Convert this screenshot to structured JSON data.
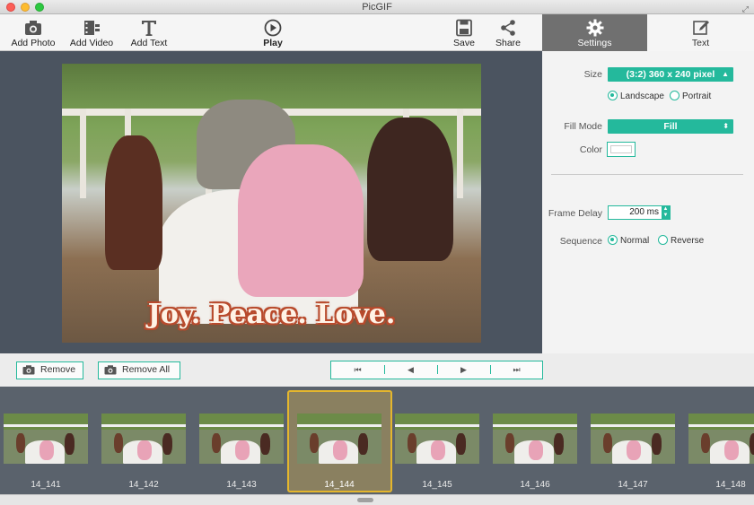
{
  "window": {
    "title": "PicGIF"
  },
  "toolbar": {
    "add_photo": "Add Photo",
    "add_video": "Add Video",
    "add_text": "Add Text",
    "play": "Play",
    "save": "Save",
    "share": "Share"
  },
  "tabs": {
    "settings": "Settings",
    "text": "Text"
  },
  "preview": {
    "caption": "Joy. Peace. Love."
  },
  "settings": {
    "size_label": "Size",
    "size_value": "(3:2) 360 x 240 pixel",
    "orientation": {
      "landscape": "Landscape",
      "portrait": "Portrait",
      "selected": "landscape"
    },
    "fill_mode_label": "Fill Mode",
    "fill_mode_value": "Fill",
    "color_label": "Color",
    "color_value": "#ffffff",
    "frame_delay_label": "Frame Delay",
    "frame_delay_value": "200 ms",
    "sequence_label": "Sequence",
    "sequence": {
      "normal": "Normal",
      "reverse": "Reverse",
      "selected": "normal"
    }
  },
  "actions": {
    "remove": "Remove",
    "remove_all": "Remove All"
  },
  "nav": {
    "first": "⏮",
    "prev": "◀",
    "next": "▶",
    "last": "⏭"
  },
  "frames": [
    {
      "label": "14_141"
    },
    {
      "label": "14_142"
    },
    {
      "label": "14_143"
    },
    {
      "label": "14_144",
      "selected": true
    },
    {
      "label": "14_145"
    },
    {
      "label": "14_146"
    },
    {
      "label": "14_147"
    },
    {
      "label": "14_148"
    }
  ],
  "colors": {
    "accent": "#24b99c",
    "selection": "#e4b62d",
    "settings_tab": "#707070",
    "preview_bg": "#4b5460"
  }
}
